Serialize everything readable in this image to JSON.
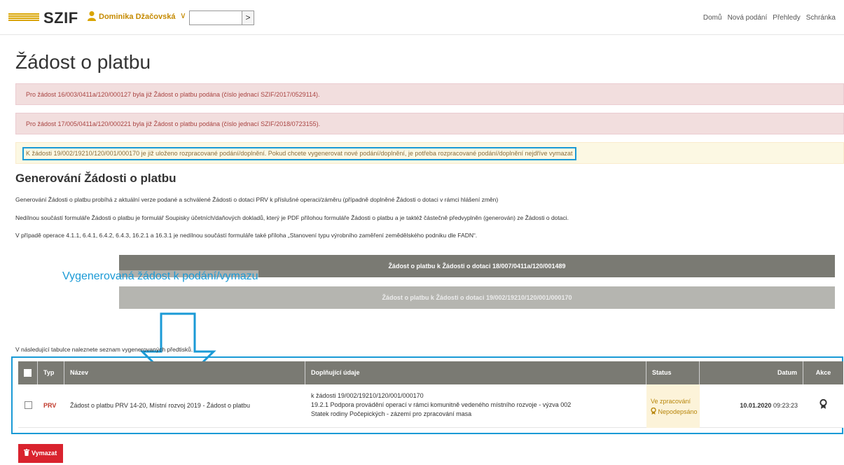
{
  "header": {
    "brand": "SZIF",
    "user_name": "Dominika Džačovská",
    "user_caret": "∨",
    "go_label": ">",
    "nav": [
      "Domů",
      "Nová podání",
      "Přehledy",
      "Schránka"
    ]
  },
  "page_title": "Žádost o platbu",
  "alerts": [
    {
      "text": "Pro žádost 16/003/0411a/120/000127 byla již Žádost o platbu podána (číslo jednací SZIF/2017/0529114)."
    },
    {
      "text": "Pro žádost 17/005/0411a/120/000221 byla již Žádost o platbu podána (číslo jednací SZIF/2018/0723155)."
    },
    {
      "text": "K žádosti 19/002/19210/120/001/000170 je již uloženo rozpracované podání/doplnění. Pokud chcete vygenerovat nové podání/doplnění, je potřeba rozpracované podání/doplnění nejdříve vymazat"
    }
  ],
  "section_title": "Generování Žádosti o platbu",
  "paragraphs": [
    "Generování Žádosti o platbu probíhá z aktuální verze podané a schválené Žádosti o dotaci PRV k příslušné operaci/záměru (případně doplněné Žádosti o dotaci v rámci hlášení změn)",
    "Nedílnou součástí formuláře Žádosti o platbu je formulář Soupisky účetních/daňových dokladů, který je PDF přílohou formuláře Žádosti o platbu a je taktéž částečně předvyplněn (generován) ze Žádosti o dotaci.",
    "V případě operace 4.1.1, 6.4.1, 6.4.2, 6.4.3, 16.2.1 a 16.3.1 je nedílnou součástí formuláře také příloha „Stanovení typu výrobního zaměření zemědělského podniku dle FADN“."
  ],
  "buttons": {
    "generate_1": "Žádost o platbu k Žádosti o dotaci 18/007/0411a/120/001489",
    "generate_2": "Žádost o platbu k Žádosti o dotaci 19/002/19210/120/001/000170",
    "delete": "Vymazat"
  },
  "annotation": "Vygenerovaná žádost k podání/vymazu",
  "table_note": "V následující tabulce naleznete seznam vygenerovaných předtisků.",
  "table": {
    "columns": [
      "Typ",
      "Název",
      "Doplňující údaje",
      "Status",
      "Datum",
      "Akce"
    ],
    "rows": [
      {
        "typ": "PRV",
        "nazev": "Žádost o platbu PRV 14-20, Místní rozvoj 2019 - Žádost o platbu",
        "info_1": "k žádosti 19/002/19210/120/001/000170",
        "info_2": "19.2.1 Podpora provádění operací v rámci komunitně vedeného místního rozvoje - výzva 002",
        "info_3": "Statek rodiny Počepických - zázemí pro zpracování masa",
        "status_1": "Ve zpracování",
        "status_2": "Nepodepsáno",
        "datum_date": "10.01.2020",
        "datum_time": "09:23:23"
      }
    ]
  },
  "colors": {
    "accent": "#1a9ad6",
    "brand_gold": "#d9a400",
    "header_gray": "#7a7a73",
    "danger": "#d9232e"
  }
}
